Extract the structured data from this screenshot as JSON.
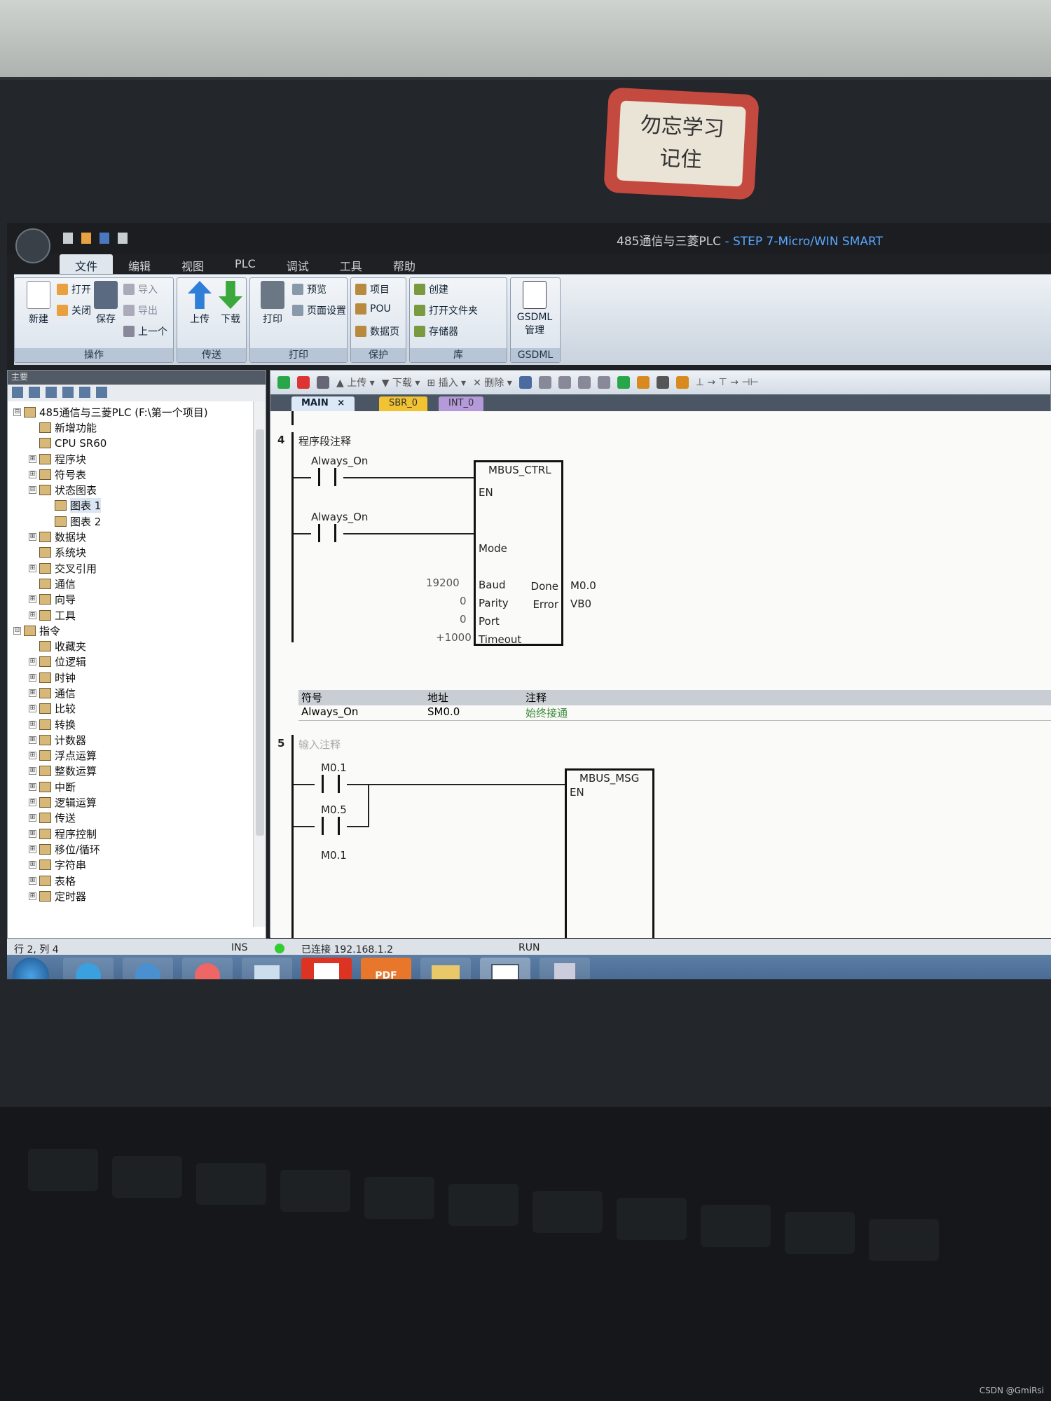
{
  "sticker": {
    "line1": "勿忘学习",
    "line2": "记住"
  },
  "window": {
    "title": "485通信与三菱PLC",
    "subtitle": " - STEP 7-Micro/WIN SMART"
  },
  "menu_tabs": [
    "文件",
    "编辑",
    "视图",
    "PLC",
    "调试",
    "工具",
    "帮助"
  ],
  "ribbon": {
    "new": "新建",
    "open": "打开",
    "close": "关闭",
    "save": "保存",
    "import": "导入",
    "export": "导出",
    "prev": "上一个",
    "operate": "操作",
    "upload": "上传",
    "download": "下载",
    "transfer": "传送",
    "print": "打印",
    "preview": "预览",
    "page_setup": "页面设置",
    "print_group": "打印",
    "project": "项目",
    "pou": "POU",
    "datapage": "数据页",
    "protect": "保护",
    "create": "创建",
    "open_folder": "打开文件夹",
    "storage": "存储器",
    "library": "库",
    "gsdml": "GSDML",
    "gsdml_manage": "GSDML\n管理",
    "gsdml_group": "GSDML"
  },
  "nav": {
    "header": "主要",
    "tree": [
      {
        "label": "485通信与三菱PLC (F:\\第一个项目)",
        "depth": 0,
        "exp": "⊟"
      },
      {
        "label": "新增功能",
        "depth": 1,
        "exp": ""
      },
      {
        "label": "CPU SR60",
        "depth": 1,
        "exp": ""
      },
      {
        "label": "程序块",
        "depth": 1,
        "exp": "⊞"
      },
      {
        "label": "符号表",
        "depth": 1,
        "exp": "⊞"
      },
      {
        "label": "状态图表",
        "depth": 1,
        "exp": "⊟"
      },
      {
        "label": "图表 1",
        "depth": 2,
        "exp": "",
        "sel": true
      },
      {
        "label": "图表 2",
        "depth": 2,
        "exp": ""
      },
      {
        "label": "数据块",
        "depth": 1,
        "exp": "⊞"
      },
      {
        "label": "系统块",
        "depth": 1,
        "exp": ""
      },
      {
        "label": "交叉引用",
        "depth": 1,
        "exp": "⊞"
      },
      {
        "label": "通信",
        "depth": 1,
        "exp": ""
      },
      {
        "label": "向导",
        "depth": 1,
        "exp": "⊞"
      },
      {
        "label": "工具",
        "depth": 1,
        "exp": "⊞"
      },
      {
        "label": "指令",
        "depth": 0,
        "exp": "⊟"
      },
      {
        "label": "收藏夹",
        "depth": 1,
        "exp": ""
      },
      {
        "label": "位逻辑",
        "depth": 1,
        "exp": "⊞"
      },
      {
        "label": "时钟",
        "depth": 1,
        "exp": "⊞"
      },
      {
        "label": "通信",
        "depth": 1,
        "exp": "⊞"
      },
      {
        "label": "比较",
        "depth": 1,
        "exp": "⊞"
      },
      {
        "label": "转换",
        "depth": 1,
        "exp": "⊞"
      },
      {
        "label": "计数器",
        "depth": 1,
        "exp": "⊞"
      },
      {
        "label": "浮点运算",
        "depth": 1,
        "exp": "⊞"
      },
      {
        "label": "整数运算",
        "depth": 1,
        "exp": "⊞"
      },
      {
        "label": "中断",
        "depth": 1,
        "exp": "⊞"
      },
      {
        "label": "逻辑运算",
        "depth": 1,
        "exp": "⊞"
      },
      {
        "label": "传送",
        "depth": 1,
        "exp": "⊞"
      },
      {
        "label": "程序控制",
        "depth": 1,
        "exp": "⊞"
      },
      {
        "label": "移位/循环",
        "depth": 1,
        "exp": "⊞"
      },
      {
        "label": "字符串",
        "depth": 1,
        "exp": "⊞"
      },
      {
        "label": "表格",
        "depth": 1,
        "exp": "⊞"
      },
      {
        "label": "定时器",
        "depth": 1,
        "exp": "⊞"
      }
    ]
  },
  "editor": {
    "toolbar": {
      "upload": "上传",
      "download": "下载",
      "insert": "插入",
      "delete": "删除"
    },
    "tabs": [
      "MAIN",
      "SBR_0",
      "INT_0"
    ],
    "tab_close": "×",
    "net4": {
      "num": "4",
      "comment": "程序段注释",
      "c1": "Always_On",
      "c2": "Always_On",
      "block": "MBUS_CTRL",
      "en": "EN",
      "mode": "Mode",
      "baud": "Baud",
      "parity": "Parity",
      "port": "Port",
      "timeout": "Timeout",
      "baud_v": "19200",
      "parity_v": "0",
      "port_v": "0",
      "timeout_v": "+1000",
      "done": "Done",
      "error": "Error",
      "done_v": "M0.0",
      "error_v": "VB0"
    },
    "symtable": {
      "h1": "符号",
      "h2": "地址",
      "h3": "注释",
      "sym": "Always_On",
      "addr": "SM0.0",
      "cmt": "始终接通"
    },
    "net5": {
      "num": "5",
      "comment": "输入注释",
      "c1": "M0.1",
      "c2": "M0.5",
      "c3": "M0.1",
      "block": "MBUS_MSG",
      "en": "EN"
    }
  },
  "status": {
    "pos": "行 2, 列 4",
    "ins": "INS",
    "conn": "已连接 192.168.1.2",
    "run": "RUN"
  },
  "taskbar": {
    "pdf": "PDF"
  },
  "watermark": "CSDN @GmiRsi"
}
